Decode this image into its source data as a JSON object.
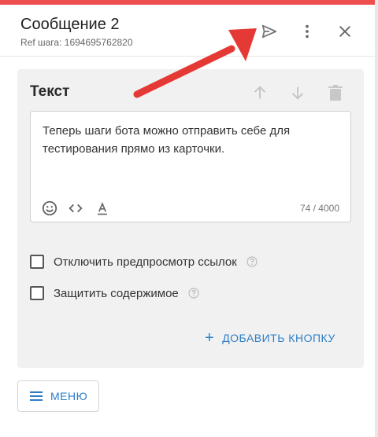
{
  "header": {
    "title": "Сообщение 2",
    "ref": "Ref шага: 1694695762820"
  },
  "card": {
    "title": "Текст",
    "text": "Теперь шаги бота можно отправить себе для тестирования прямо из карточки.",
    "counter": "74 / 4000"
  },
  "options": {
    "disable_preview": "Отключить предпросмотр ссылок",
    "protect_content": "Защитить содержимое"
  },
  "add_button_label": "ДОБАВИТЬ КНОПКУ",
  "menu_label": "МЕНЮ",
  "colors": {
    "accent_top": "#ef4e4e",
    "link_blue": "#2e7fc8",
    "annotation_arrow": "#e53935"
  }
}
